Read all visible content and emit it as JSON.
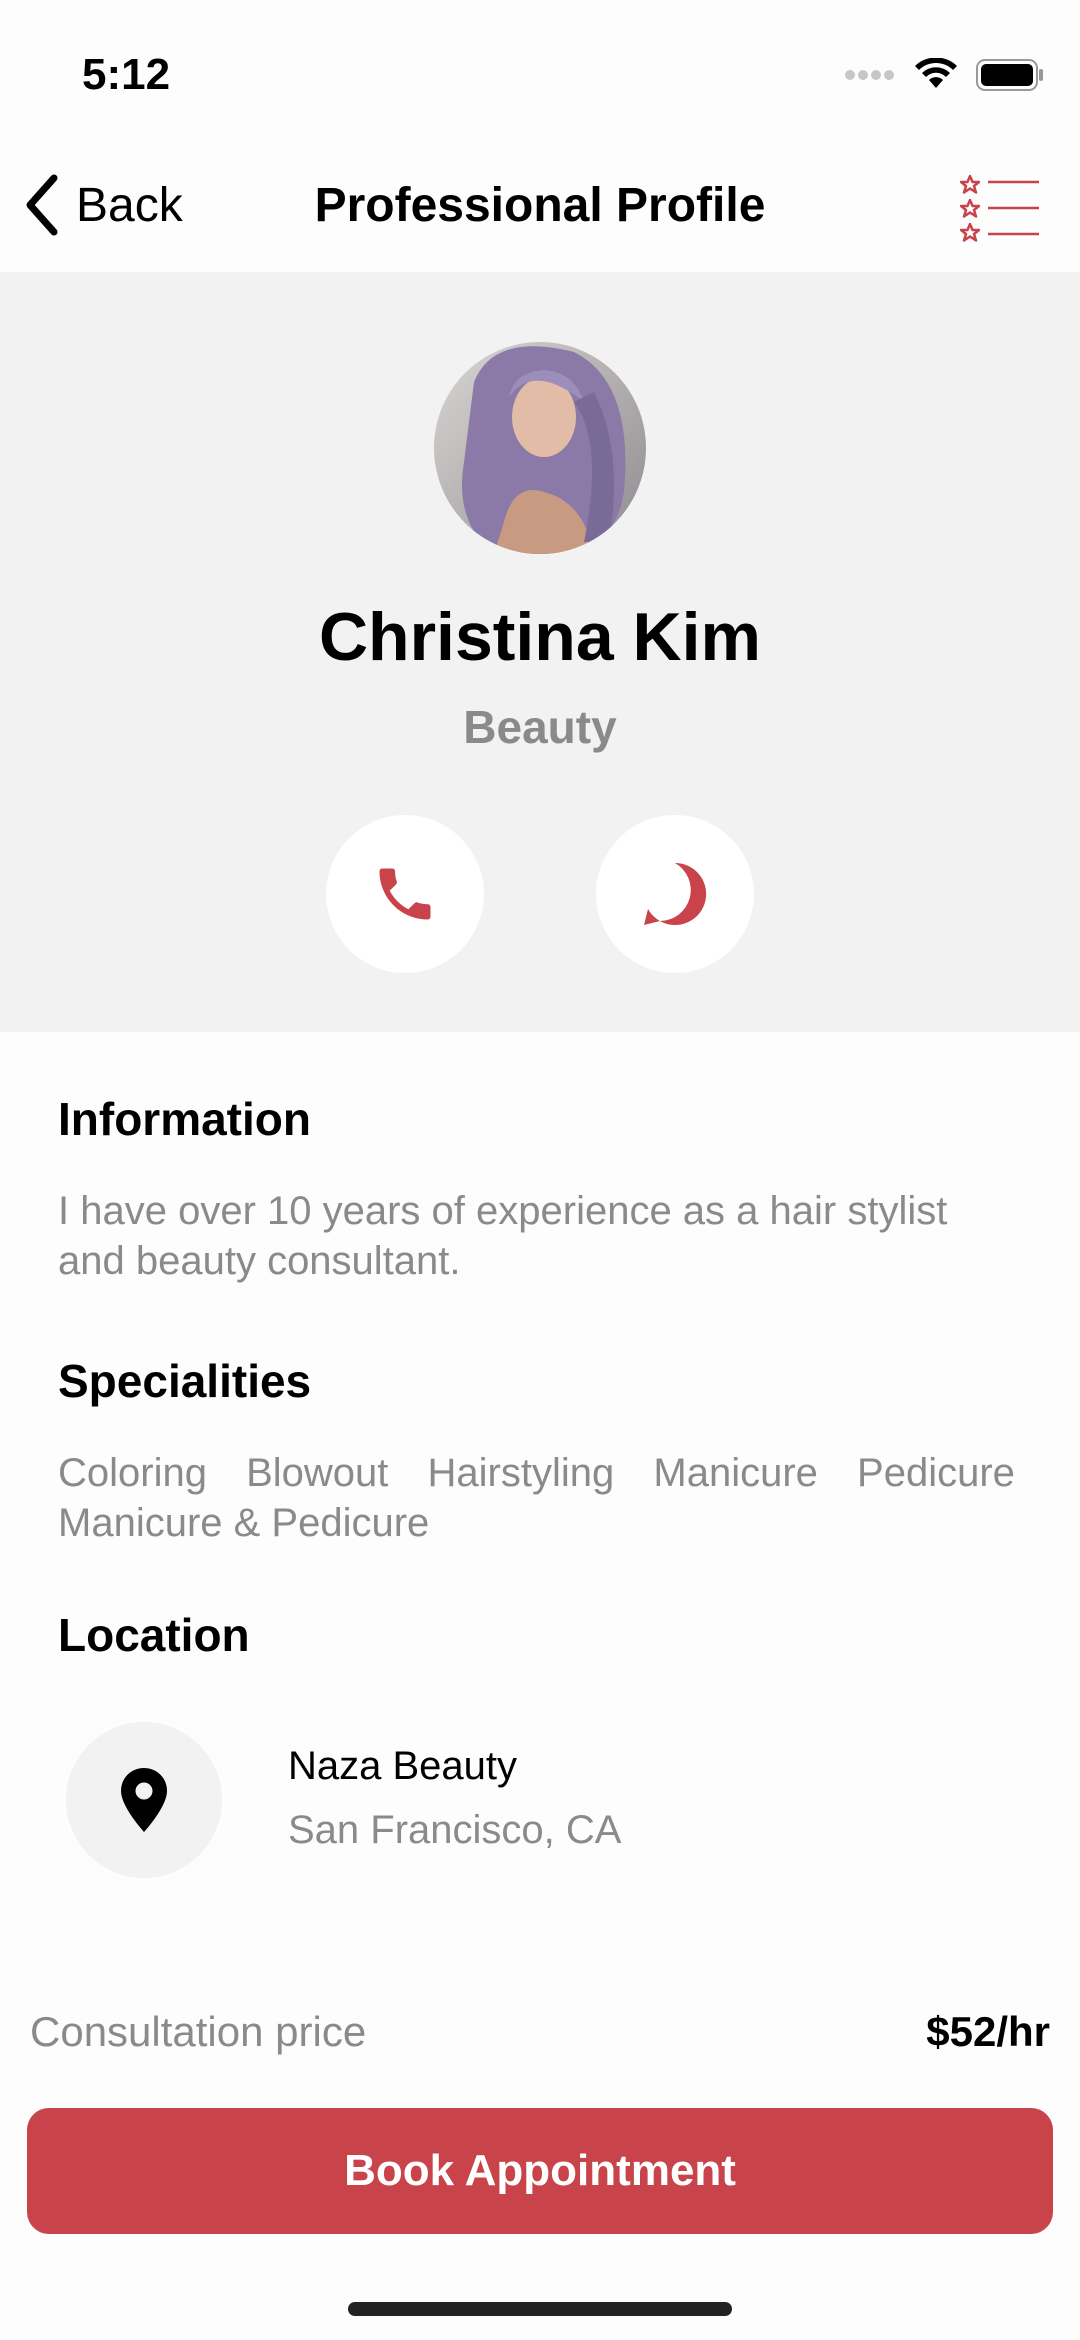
{
  "status_bar": {
    "time": "5:12"
  },
  "nav": {
    "back_label": "Back",
    "title": "Professional Profile"
  },
  "profile": {
    "name": "Christina Kim",
    "category": "Beauty"
  },
  "information": {
    "title": "Information",
    "text": "I have over 10 years of experience as a hair stylist and beauty consultant."
  },
  "specialities": {
    "title": "Specialities",
    "items": [
      "Coloring",
      "Blowout",
      "Hairstyling",
      "Manicure",
      "Pedicure",
      "Manicure & Pedicure"
    ]
  },
  "location": {
    "title": "Location",
    "name": "Naza Beauty",
    "city": "San Francisco, CA"
  },
  "pricing": {
    "label": "Consultation price",
    "value": "$52/hr"
  },
  "cta": {
    "label": "Book Appointment"
  },
  "colors": {
    "accent": "#c8434a",
    "muted_text": "#8a8a8a",
    "header_bg": "#f2f2f2"
  }
}
